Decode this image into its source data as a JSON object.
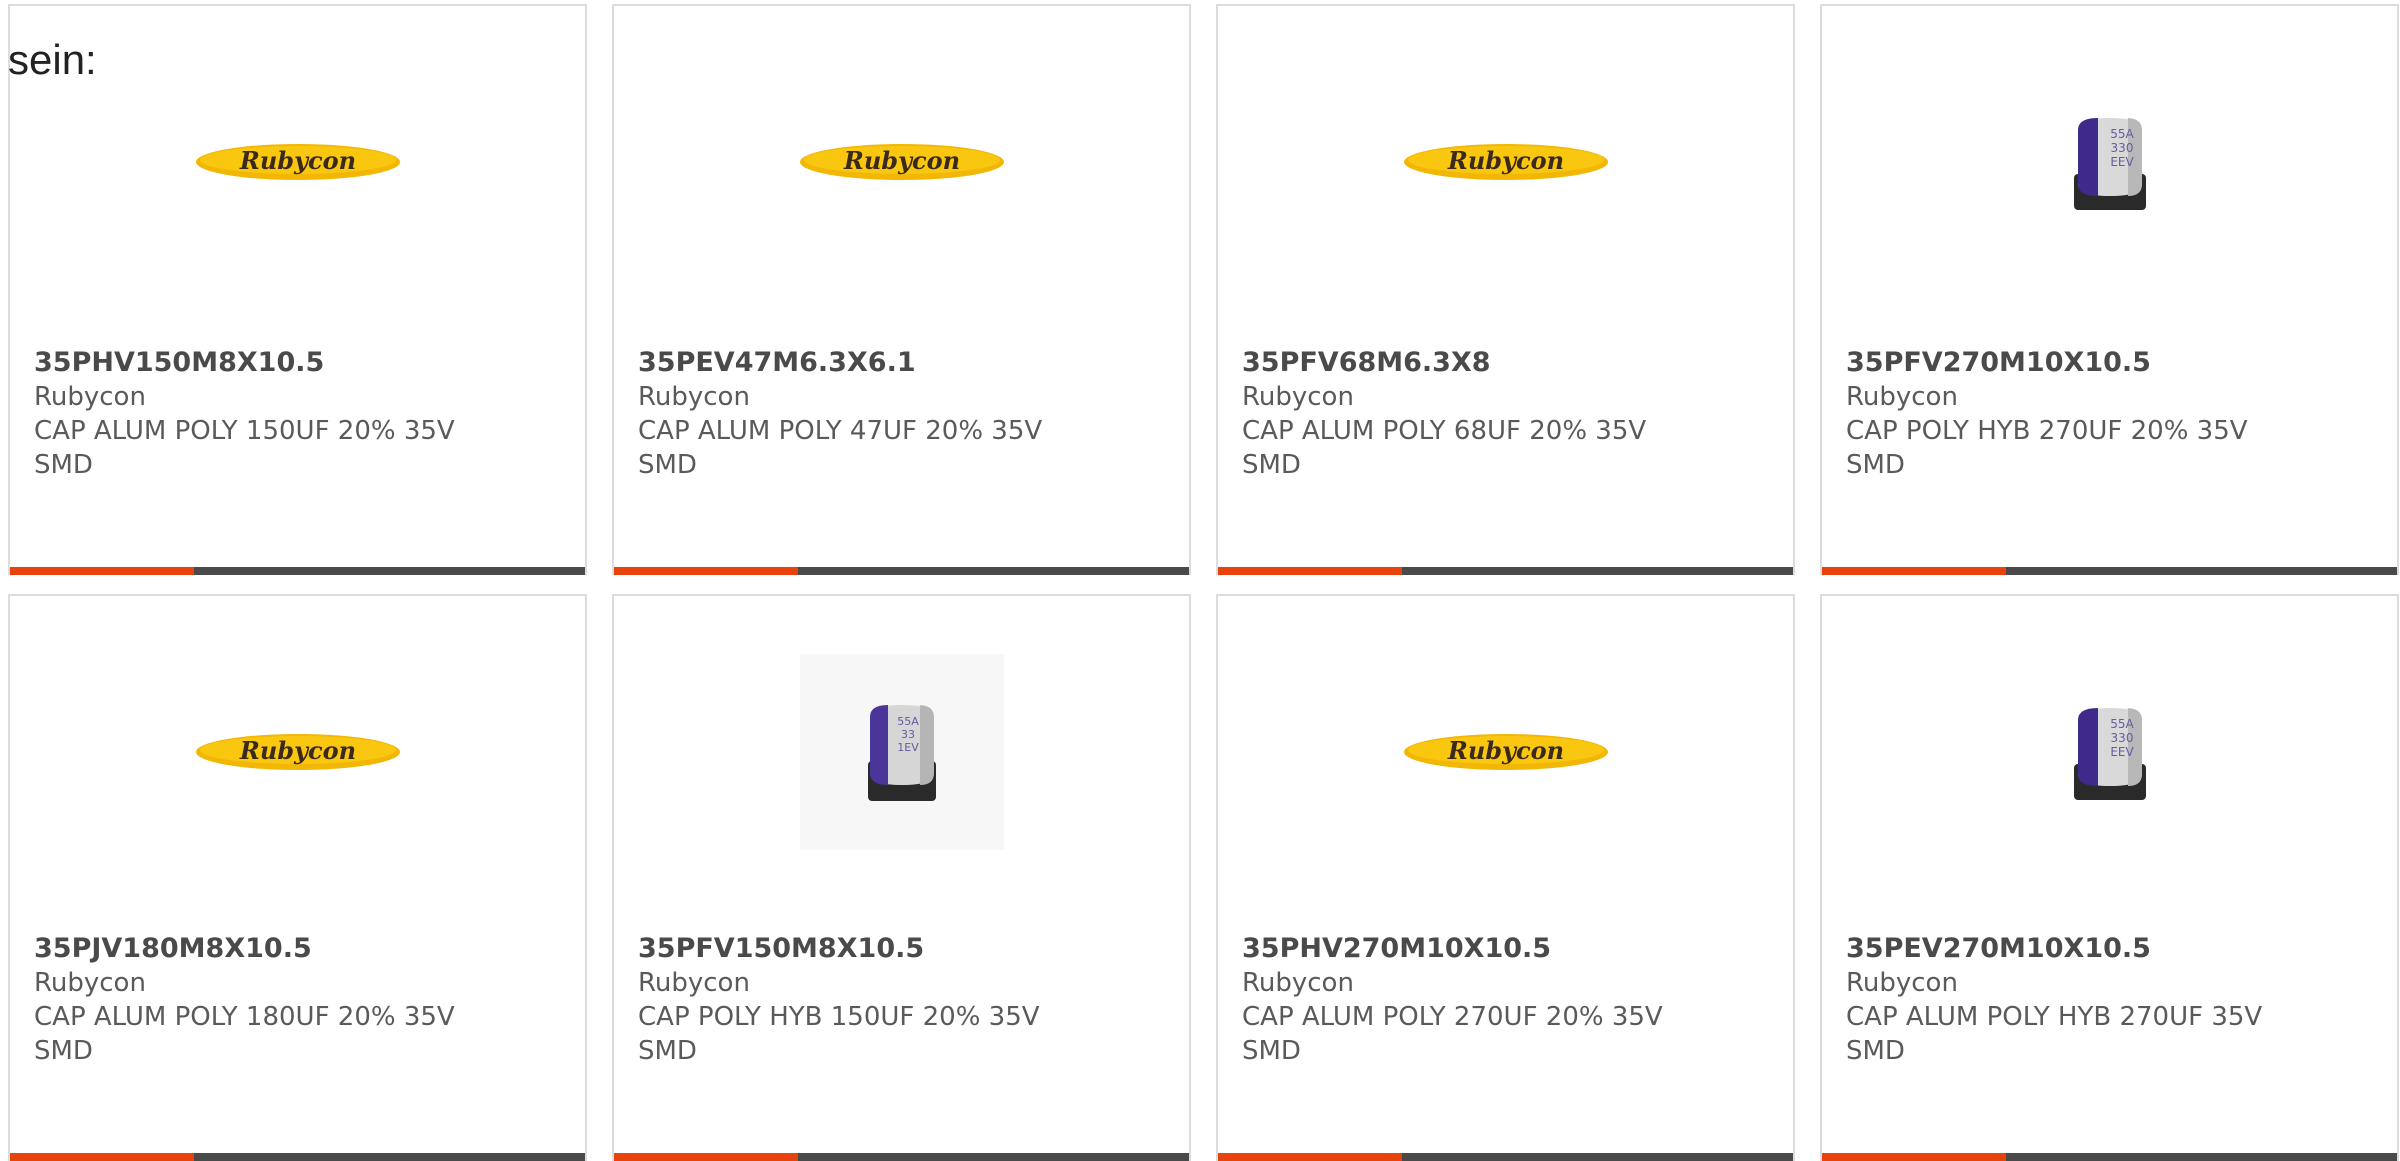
{
  "intro_text": "sein:",
  "colors": {
    "accent": "#e8430d",
    "bar_track": "#4a4a4a",
    "border": "#dcdcdc"
  },
  "products": [
    {
      "part_number": "35PHV150M8X10.5",
      "manufacturer": "Rubycon",
      "description": "CAP ALUM POLY 150UF 20% 35V SMD",
      "image": "rubycon-logo",
      "progress": 0.32
    },
    {
      "part_number": "35PEV47M6.3X6.1",
      "manufacturer": "Rubycon",
      "description": "CAP ALUM POLY 47UF 20% 35V SMD",
      "image": "rubycon-logo",
      "progress": 0.32
    },
    {
      "part_number": "35PFV68M6.3X8",
      "manufacturer": "Rubycon",
      "description": "CAP ALUM POLY 68UF 20% 35V SMD",
      "image": "rubycon-logo",
      "progress": 0.32
    },
    {
      "part_number": "35PFV270M10X10.5",
      "manufacturer": "Rubycon",
      "description": "CAP POLY HYB 270UF 20% 35V SMD",
      "image": "capacitor-photo",
      "progress": 0.32
    },
    {
      "part_number": "35PJV180M8X10.5",
      "manufacturer": "Rubycon",
      "description": "CAP ALUM POLY 180UF 20% 35V SMD",
      "image": "rubycon-logo",
      "progress": 0.32
    },
    {
      "part_number": "35PFV150M8X10.5",
      "manufacturer": "Rubycon",
      "description": "CAP POLY HYB 150UF 20% 35V SMD",
      "image": "capacitor-photo-framed",
      "progress": 0.32
    },
    {
      "part_number": "35PHV270M10X10.5",
      "manufacturer": "Rubycon",
      "description": "CAP ALUM POLY 270UF 20% 35V SMD",
      "image": "rubycon-logo",
      "progress": 0.32
    },
    {
      "part_number": "35PEV270M10X10.5",
      "manufacturer": "Rubycon",
      "description": "CAP ALUM POLY HYB 270UF 35V SMD",
      "image": "capacitor-photo",
      "progress": 0.32
    }
  ],
  "logo_text": "Rubycon",
  "capacitor_marking": [
    "55A",
    "330",
    "EEV"
  ],
  "capacitor_marking_small": [
    "55A",
    "33",
    "1EV"
  ]
}
